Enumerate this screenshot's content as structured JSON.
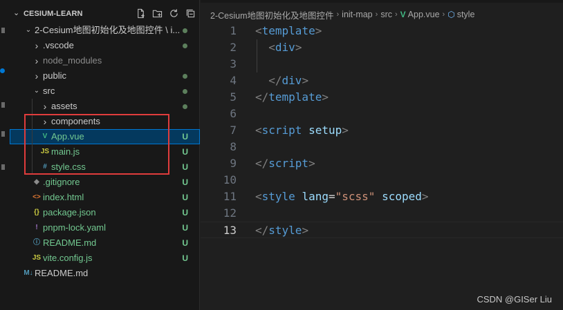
{
  "explorer": {
    "root_label": "CESIUM-LEARN",
    "actions": [
      {
        "name": "new-file-icon"
      },
      {
        "name": "new-folder-icon"
      },
      {
        "name": "refresh-icon"
      },
      {
        "name": "collapse-all-icon"
      }
    ],
    "tree": [
      {
        "label": "2-Cesium地图初始化及地图控件 \\ i...",
        "kind": "folder-open",
        "depth": 0,
        "badge": "dot"
      },
      {
        "label": ".vscode",
        "kind": "folder",
        "depth": 1,
        "badge": "dot"
      },
      {
        "label": "node_modules",
        "kind": "folder",
        "depth": 1,
        "badge": "",
        "dim": true
      },
      {
        "label": "public",
        "kind": "folder",
        "depth": 1,
        "badge": "dot"
      },
      {
        "label": "src",
        "kind": "folder-open",
        "depth": 1,
        "badge": "dot"
      },
      {
        "label": "assets",
        "kind": "folder",
        "depth": 2,
        "badge": "dot"
      },
      {
        "label": "components",
        "kind": "folder",
        "depth": 2,
        "badge": ""
      },
      {
        "label": "App.vue",
        "kind": "vue",
        "depth": 2,
        "badge": "U",
        "selected": true
      },
      {
        "label": "main.js",
        "kind": "js",
        "depth": 2,
        "badge": "U"
      },
      {
        "label": "style.css",
        "kind": "css",
        "depth": 2,
        "badge": "U"
      },
      {
        "label": ".gitignore",
        "kind": "git",
        "depth": 1,
        "badge": "U"
      },
      {
        "label": "index.html",
        "kind": "html",
        "depth": 1,
        "badge": "U"
      },
      {
        "label": "package.json",
        "kind": "json",
        "depth": 1,
        "badge": "U"
      },
      {
        "label": "pnpm-lock.yaml",
        "kind": "yaml",
        "depth": 1,
        "badge": "U"
      },
      {
        "label": "README.md",
        "kind": "info",
        "depth": 1,
        "badge": "U"
      },
      {
        "label": "vite.config.js",
        "kind": "js",
        "depth": 1,
        "badge": "U"
      },
      {
        "label": "README.md",
        "kind": "md",
        "depth": 0,
        "badge": ""
      }
    ],
    "icon_glyphs": {
      "vue": "V",
      "js": "JS",
      "css": "#",
      "git": "◆",
      "html": "<>",
      "json": "{}",
      "yaml": "!",
      "info": "ⓘ",
      "md": "M↓"
    },
    "icon_colors": {
      "vue": "#41b883",
      "js": "#cbcb41",
      "css": "#519aba",
      "git": "#8b8b8b",
      "html": "#e37933",
      "json": "#cbcb41",
      "yaml": "#a074c4",
      "info": "#519aba",
      "md": "#519aba"
    }
  },
  "breadcrumb": {
    "items": [
      "2-Cesium地图初始化及地图控件",
      "init-map",
      "src",
      "App.vue",
      "style"
    ],
    "vue_glyph": "V",
    "style_glyph": "⬡"
  },
  "editor": {
    "current_line": 13,
    "lines": [
      {
        "n": "1",
        "tokens": [
          [
            "punc",
            "<"
          ],
          [
            "tag",
            "template"
          ],
          [
            "punc",
            ">"
          ]
        ]
      },
      {
        "n": "2",
        "tokens": [
          [
            "plain",
            "  "
          ],
          [
            "punc",
            "<"
          ],
          [
            "tag",
            "div"
          ],
          [
            "punc",
            ">"
          ]
        ]
      },
      {
        "n": "3",
        "tokens": []
      },
      {
        "n": "4",
        "tokens": [
          [
            "plain",
            "  "
          ],
          [
            "punc",
            "</"
          ],
          [
            "tag",
            "div"
          ],
          [
            "punc",
            ">"
          ]
        ]
      },
      {
        "n": "5",
        "tokens": [
          [
            "punc",
            "</"
          ],
          [
            "tag",
            "template"
          ],
          [
            "punc",
            ">"
          ]
        ]
      },
      {
        "n": "6",
        "tokens": []
      },
      {
        "n": "7",
        "tokens": [
          [
            "punc",
            "<"
          ],
          [
            "tag",
            "script"
          ],
          [
            "plain",
            " "
          ],
          [
            "attr",
            "setup"
          ],
          [
            "punc",
            ">"
          ]
        ]
      },
      {
        "n": "8",
        "tokens": []
      },
      {
        "n": "9",
        "tokens": [
          [
            "punc",
            "</"
          ],
          [
            "tag",
            "script"
          ],
          [
            "punc",
            ">"
          ]
        ]
      },
      {
        "n": "10",
        "tokens": []
      },
      {
        "n": "11",
        "tokens": [
          [
            "punc",
            "<"
          ],
          [
            "tag",
            "style"
          ],
          [
            "plain",
            " "
          ],
          [
            "attr",
            "lang"
          ],
          [
            "plain",
            "="
          ],
          [
            "str",
            "\"scss\""
          ],
          [
            "plain",
            " "
          ],
          [
            "attr",
            "scoped"
          ],
          [
            "punc",
            ">"
          ]
        ]
      },
      {
        "n": "12",
        "tokens": []
      },
      {
        "n": "13",
        "tokens": [
          [
            "punc",
            "</"
          ],
          [
            "tag",
            "style"
          ],
          [
            "punc",
            ">"
          ]
        ]
      }
    ]
  },
  "watermark": "CSDN @GISer Liu"
}
